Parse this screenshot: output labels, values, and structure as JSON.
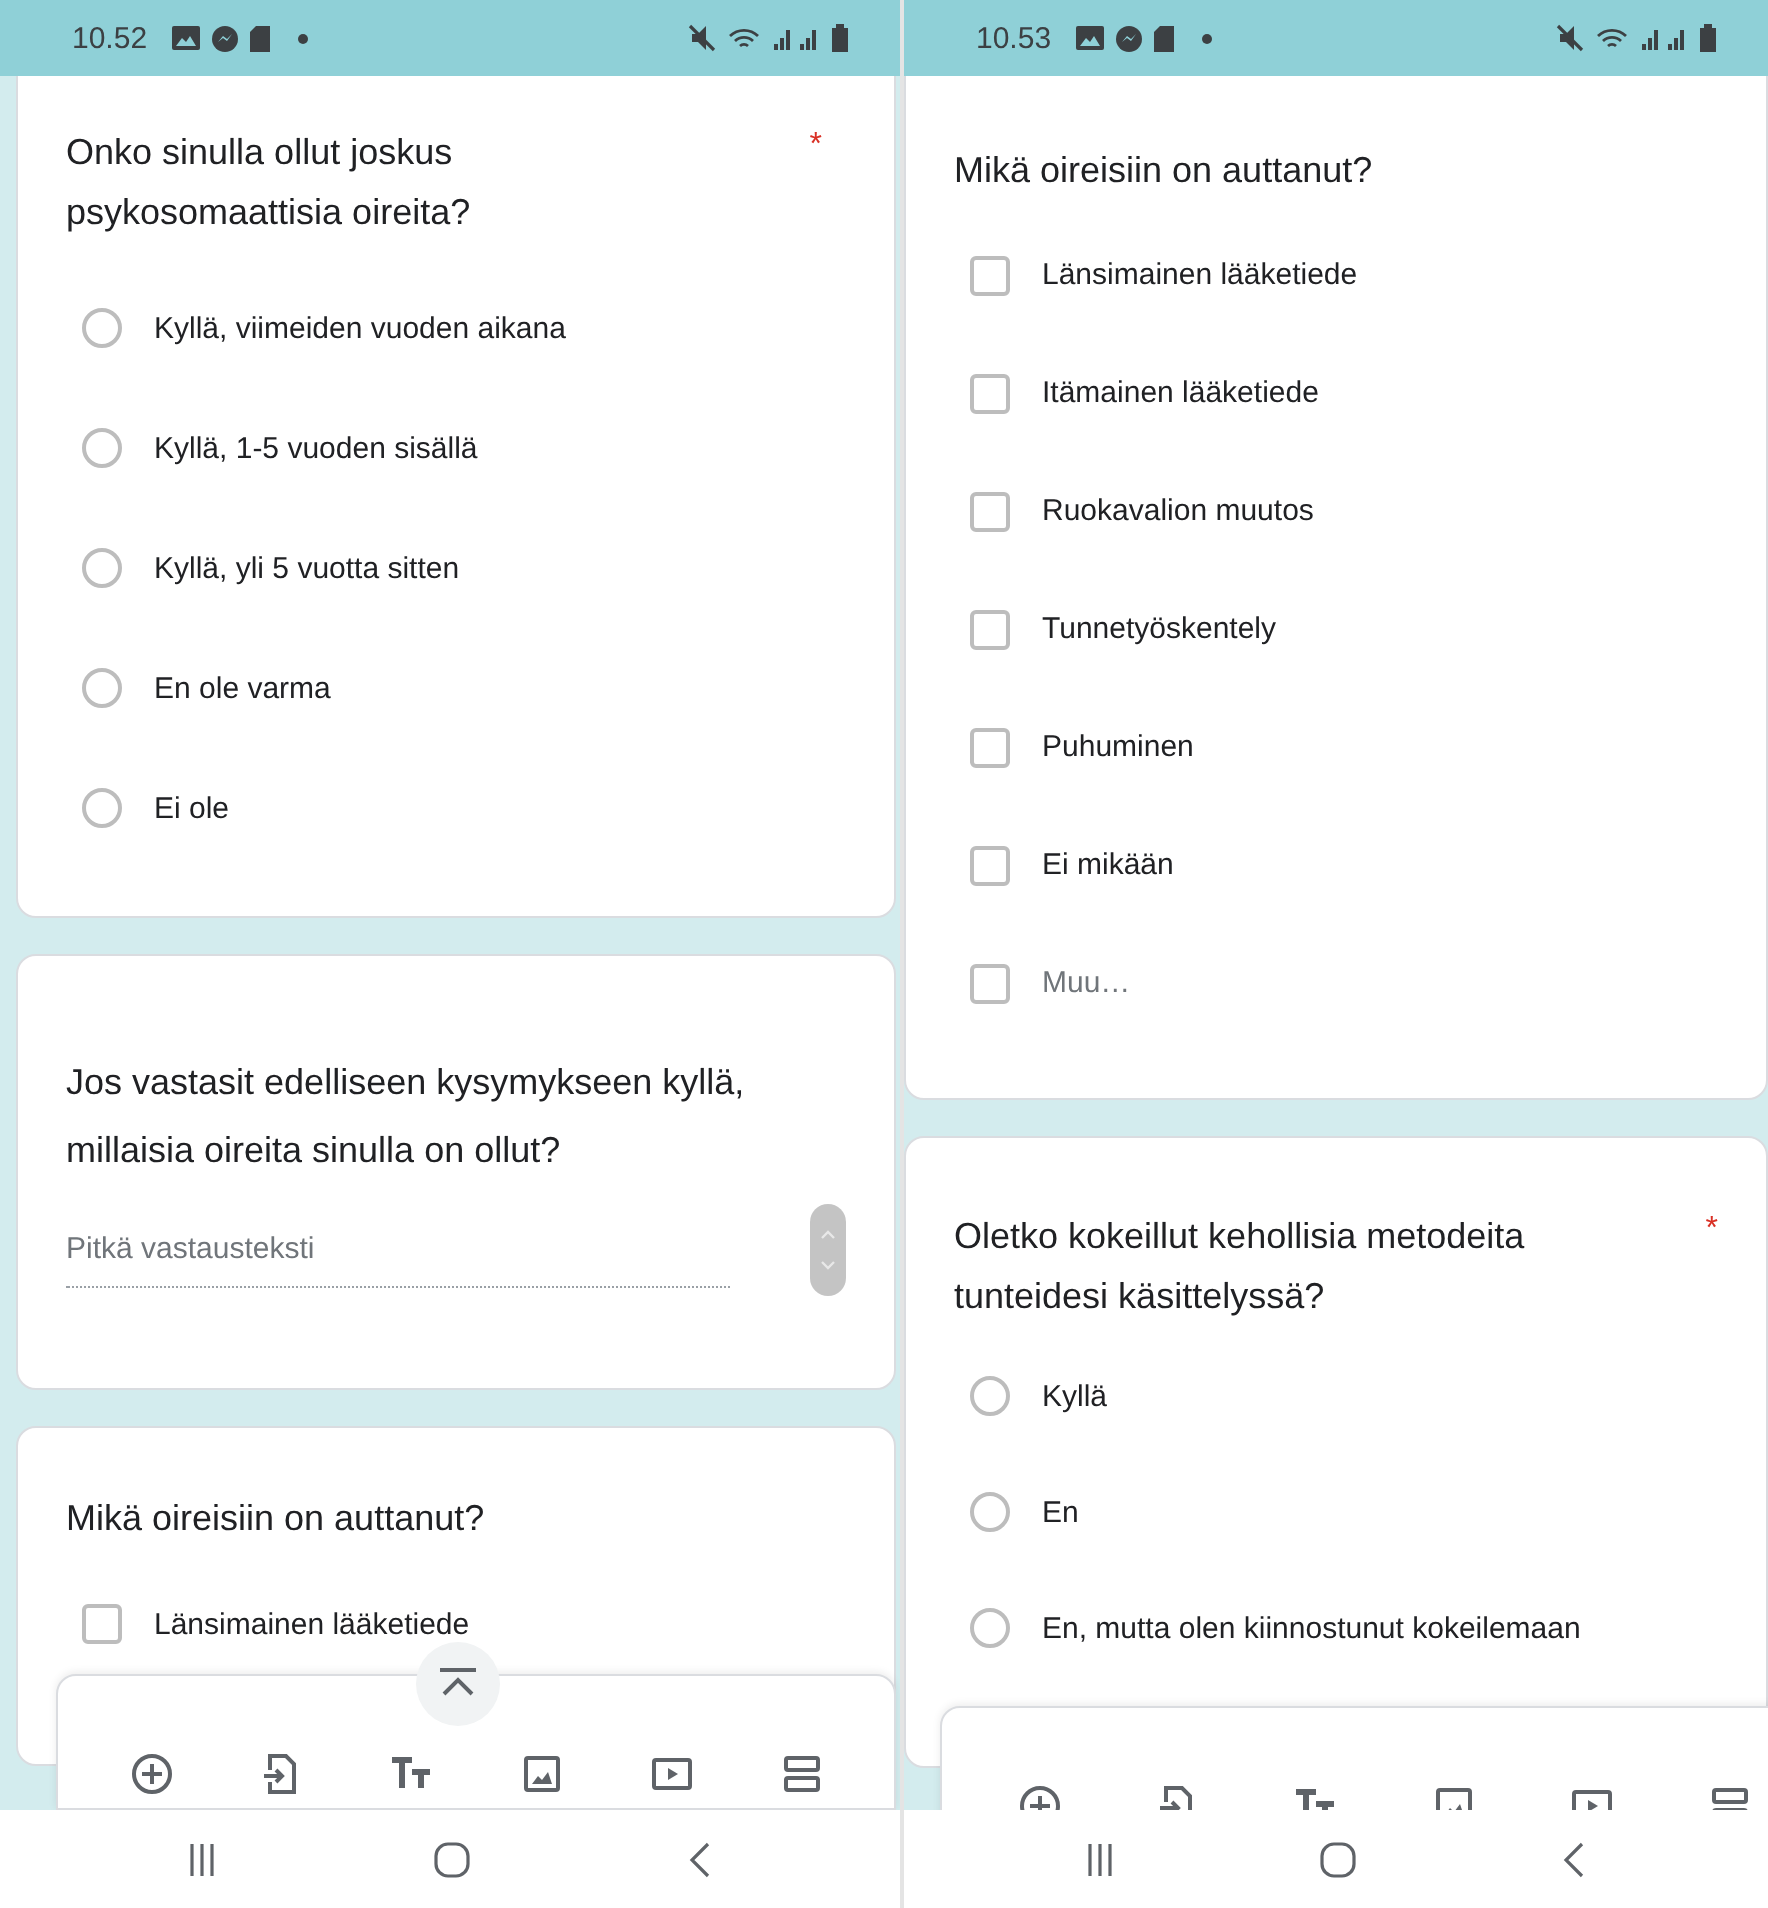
{
  "phones": [
    {
      "status_bar": {
        "time": "10.52"
      },
      "cards": [
        {
          "kind": "radio",
          "title": "Onko sinulla ollut joskus psykosomaattisia oireita?",
          "required_mark": "*",
          "options": [
            {
              "label": "Kyllä, viimeiden vuoden aikana",
              "selected": false
            },
            {
              "label": "Kyllä, 1-5 vuoden sisällä",
              "selected": false
            },
            {
              "label": "Kyllä, yli 5 vuotta sitten",
              "selected": false
            },
            {
              "label": "En ole varma",
              "selected": false
            },
            {
              "label": "Ei ole",
              "selected": false
            }
          ]
        },
        {
          "kind": "paragraph",
          "title": "Jos vastasit edelliseen kysymykseen kyllä, millaisia oireita sinulla on ollut?",
          "placeholder": "Pitkä vastausteksti"
        },
        {
          "kind": "checkbox",
          "title": "Mikä oireisiin on auttanut?",
          "options": [
            {
              "label": "Länsimainen lääketiede",
              "checked": false,
              "other": false
            }
          ]
        }
      ],
      "toolbar": {
        "scroll_top_button": true
      }
    },
    {
      "status_bar": {
        "time": "10.53"
      },
      "cards": [
        {
          "kind": "checkbox",
          "title": "Mikä oireisiin on auttanut?",
          "options": [
            {
              "label": "Länsimainen lääketiede",
              "checked": false,
              "other": false
            },
            {
              "label": "Itämainen lääketiede",
              "checked": false,
              "other": false
            },
            {
              "label": "Ruokavalion muutos",
              "checked": false,
              "other": false
            },
            {
              "label": "Tunnetyöskentely",
              "checked": false,
              "other": false
            },
            {
              "label": "Puhuminen",
              "checked": false,
              "other": false
            },
            {
              "label": "Ei mikään",
              "checked": false,
              "other": false
            },
            {
              "label": "Muu…",
              "checked": false,
              "other": true
            }
          ]
        },
        {
          "kind": "radio",
          "title": "Oletko kokeillut kehollisia metodeita tunteidesi käsittelyssä?",
          "required_mark": "*",
          "options": [
            {
              "label": "Kyllä",
              "selected": false
            },
            {
              "label": "En",
              "selected": false
            },
            {
              "label": "En, mutta olen kiinnostunut kokeilemaan",
              "selected": false
            }
          ]
        }
      ],
      "toolbar": {
        "scroll_top_button": false
      }
    }
  ]
}
